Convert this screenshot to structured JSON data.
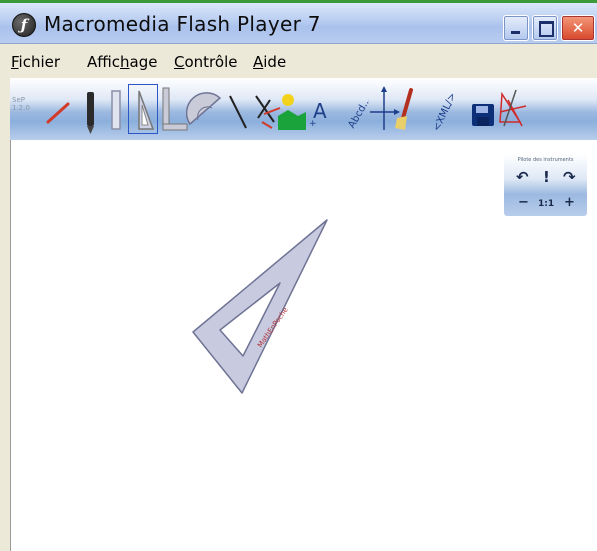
{
  "window": {
    "title": "Macromedia Flash Player 7",
    "app_icon_glyph": "ƒ",
    "controls": {
      "minimize": "",
      "maximize": "",
      "close": "✕"
    }
  },
  "menubar": {
    "items": [
      {
        "label_pre": "",
        "label_key": "F",
        "label_post": "ichier"
      },
      {
        "label_pre": "Affic",
        "label_key": "h",
        "label_post": "age"
      },
      {
        "label_pre": "",
        "label_key": "C",
        "label_post": "ontrôle"
      },
      {
        "label_pre": "",
        "label_key": "A",
        "label_post": "ide"
      }
    ]
  },
  "toolbar": {
    "version": "SeP\n1.2.0",
    "tools": [
      {
        "name": "segment-tool"
      },
      {
        "name": "pencil-tool"
      },
      {
        "name": "ruler-tool"
      },
      {
        "name": "set-square-tool",
        "selected": true
      },
      {
        "name": "protractor-l-tool"
      },
      {
        "name": "protractor-tool"
      },
      {
        "name": "line-tool"
      },
      {
        "name": "compass-tool"
      },
      {
        "name": "image-tool"
      },
      {
        "name": "text-tool",
        "glyph": "A"
      },
      {
        "name": "label-tool",
        "glyph": "Abcd..."
      },
      {
        "name": "axes-tool"
      },
      {
        "name": "brush-tool"
      },
      {
        "name": "xml-tool",
        "glyph": "<XML/>"
      },
      {
        "name": "save-tool"
      },
      {
        "name": "clear-tool"
      }
    ]
  },
  "nav_panel": {
    "title": "Pilote des instruments",
    "undo_glyph": "↶",
    "info_glyph": "!",
    "redo_glyph": "↷",
    "zoom_out_glyph": "−",
    "zoom_reset": "1:1",
    "zoom_in_glyph": "+"
  },
  "stage": {
    "set_square_label": "MathEnPoche"
  },
  "colors": {
    "set_square_fill": "#c8cbe0",
    "set_square_stroke": "#6f7394",
    "set_square_text": "#b0333a",
    "selected_border": "#2a56c8"
  }
}
